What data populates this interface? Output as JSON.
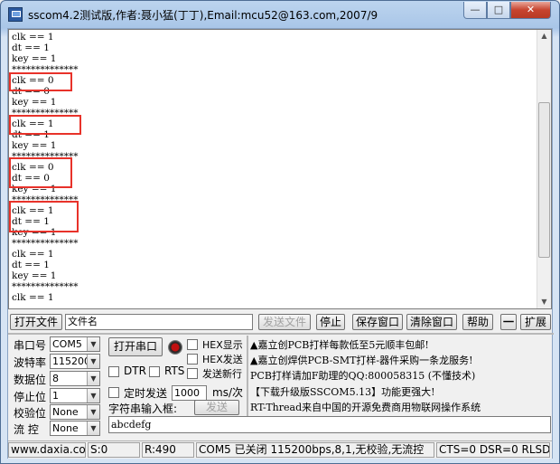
{
  "window": {
    "title": "sscom4.2测试版,作者:聂小猛(丁丁),Email:mcu52@163.com,2007/9",
    "minimize": "—",
    "maximize": "□",
    "close": "✕"
  },
  "terminal": {
    "lines": [
      "clk == 1",
      "dt == 1",
      "key == 1",
      "**************",
      "clk == 0",
      "dt == 0",
      "key == 1",
      "**************",
      "clk == 1",
      "dt == 1",
      "key == 1",
      "**************",
      "clk == 0",
      "dt == 0",
      "key == 1",
      "**************",
      "clk == 1",
      "dt == 1",
      "key == 1",
      "**************",
      "clk == 1",
      "dt == 1",
      "key == 1",
      "**************",
      "clk == 1"
    ]
  },
  "toolbar": {
    "open_file": "打开文件",
    "file_name": "文件名",
    "send_file": "发送文件",
    "stop": "停止",
    "save_window": "保存窗口",
    "clear_window": "清除窗口",
    "help": "帮助",
    "collapse": "一",
    "expand": "扩展"
  },
  "settings": {
    "port_label": "串口号",
    "port_value": "COM5",
    "baud_label": "波特率",
    "baud_value": "115200",
    "databits_label": "数据位",
    "databits_value": "8",
    "stopbits_label": "停止位",
    "stopbits_value": "1",
    "parity_label": "校验位",
    "parity_value": "None",
    "flow_label": "流  控",
    "flow_value": "None",
    "open_port": "打开串口",
    "hex_display": "HEX显示",
    "hex_send": "HEX发送",
    "dtr": "DTR",
    "rts": "RTS",
    "send_newline": "发送新行",
    "timed_send": "定时发送",
    "interval_value": "1000",
    "interval_unit": "ms/次",
    "string_input": "字符串输入框:",
    "send": "发送",
    "input_value": "abcdefg"
  },
  "ads": [
    "▲嘉立创PCB打样每款低至5元顺丰包邮!",
    "▲嘉立创焊供PCB-SMT打样-器件采购一条龙服务!",
    "PCB打样请加F助理的QQ:800058315 (不懂技术)",
    "【下载升级版SSCOM5.13】功能更强大!",
    "RT-Thread来自中国的开源免费商用物联网操作系统"
  ],
  "status": {
    "website": "www.daxia.cor",
    "sent": "S:0",
    "received": "R:490",
    "port_status": "COM5 已关闭  115200bps,8,1,无校验,无流控",
    "signals": "CTS=0 DSR=0 RLSD"
  }
}
